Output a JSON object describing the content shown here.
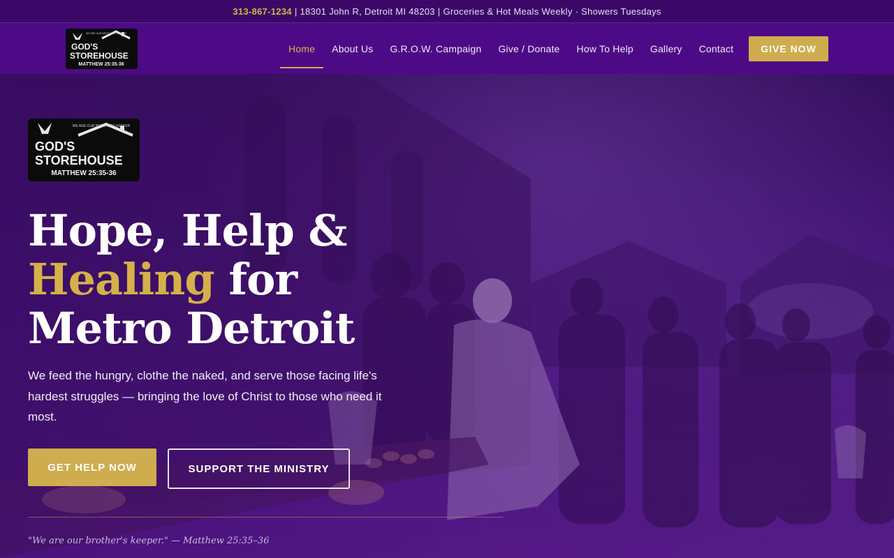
{
  "topbar": {
    "phone": "313-867-1234",
    "separator": "|",
    "address": "18301 John R, Detroit MI 48203",
    "services": "Groceries & Hot Meals Weekly · Showers Tuesdays"
  },
  "nav": {
    "logo": {
      "tagline": "WE ARE OUR BROTHERS KEEPER",
      "line1": "GOD'S",
      "line2": "STOREHOUSE",
      "line3": "MATTHEW 25:35-36"
    },
    "items": [
      {
        "label": "Home",
        "active": true
      },
      {
        "label": "About Us",
        "active": false
      },
      {
        "label": "G.R.O.W. Campaign",
        "active": false
      },
      {
        "label": "Give / Donate",
        "active": false
      },
      {
        "label": "How To Help",
        "active": false
      },
      {
        "label": "Gallery",
        "active": false
      },
      {
        "label": "Contact",
        "active": false
      }
    ],
    "cta": "GIVE NOW"
  },
  "hero": {
    "logo": {
      "tagline": "WE ARE OUR BROTHERS KEEPER",
      "line1": "GOD'S",
      "line2": "STOREHOUSE",
      "line3": "MATTHEW 25:35-36"
    },
    "title_line1": "Hope, Help &",
    "title_gold": "Healing",
    "title_line2_rest": "for",
    "title_line3": "Metro Detroit",
    "subtitle": "We feed the hungry, clothe the naked, and serve those facing life's hardest struggles — bringing the love of Christ to those who need it most.",
    "primary_button": "GET HELP NOW",
    "secondary_button": "SUPPORT THE MINISTRY",
    "quote": "\"We are our brother's keeper.\" — Matthew 25:35–36"
  },
  "colors": {
    "brand_purple": "#4d0a86",
    "topbar_purple": "#3b0868",
    "gold": "#d6b04a",
    "button_gold": "#cfac4d"
  }
}
